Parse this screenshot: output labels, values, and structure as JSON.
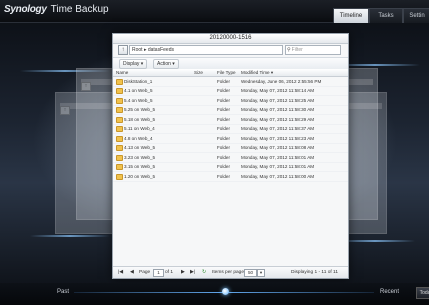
{
  "app": {
    "brand": "Synology",
    "title": "Time Backup",
    "tabs": [
      {
        "label": "Timeline",
        "active": true
      },
      {
        "label": "Tasks",
        "active": false
      },
      {
        "label": "Settin",
        "active": false
      }
    ]
  },
  "window": {
    "title": "20120000-1516",
    "path": "Root ▸ datasFeeds",
    "filter_placeholder": "Filter",
    "toolbar": {
      "display_label": "Display ▾",
      "action_label": "Action ▾"
    },
    "columns": [
      "Name",
      "Size",
      "File Type",
      "Modified Time ▾"
    ],
    "rows": [
      {
        "name": "DiskStation_1",
        "size": "",
        "type": "Folder",
        "modified": "Wednesday, June 06, 2012 2:55:56 PM"
      },
      {
        "name": "4.1 on Web_5",
        "size": "",
        "type": "Folder",
        "modified": "Monday, May 07, 2012 11:58:14 AM"
      },
      {
        "name": "5.4 on Web_5",
        "size": "",
        "type": "Folder",
        "modified": "Monday, May 07, 2012 11:58:25 AM"
      },
      {
        "name": "5.25 on Web_5",
        "size": "",
        "type": "Folder",
        "modified": "Monday, May 07, 2012 11:58:30 AM"
      },
      {
        "name": "5.18 on Web_5",
        "size": "",
        "type": "Folder",
        "modified": "Monday, May 07, 2012 11:58:29 AM"
      },
      {
        "name": "5.11 on Web_4",
        "size": "",
        "type": "Folder",
        "modified": "Monday, May 07, 2012 11:58:37 AM"
      },
      {
        "name": "4.8 on Web_4",
        "size": "",
        "type": "Folder",
        "modified": "Monday, May 07, 2012 11:58:23 AM"
      },
      {
        "name": "4.13 on Web_5",
        "size": "",
        "type": "Folder",
        "modified": "Monday, May 07, 2012 11:58:08 AM"
      },
      {
        "name": "3.23 on Web_5",
        "size": "",
        "type": "Folder",
        "modified": "Monday, May 07, 2012 11:58:01 AM"
      },
      {
        "name": "3.15 on Web_5",
        "size": "",
        "type": "Folder",
        "modified": "Monday, May 07, 2012 11:58:01 AM"
      },
      {
        "name": "1.20 on Web_5",
        "size": "",
        "type": "Folder",
        "modified": "Monday, May 07, 2012 11:58:00 AM"
      }
    ],
    "pager": {
      "page_label": "Page",
      "page_value": "1",
      "of_label": "of 1",
      "per_page_label": "Items per page",
      "per_page_value": "50",
      "displaying": "Displaying 1 - 11 of 11"
    }
  },
  "timeline": {
    "past_label": "Past",
    "recent_label": "Recent",
    "today_label": "Toda"
  },
  "colors": {
    "accent": "#62a8ee",
    "folder": "#f1c24c"
  }
}
